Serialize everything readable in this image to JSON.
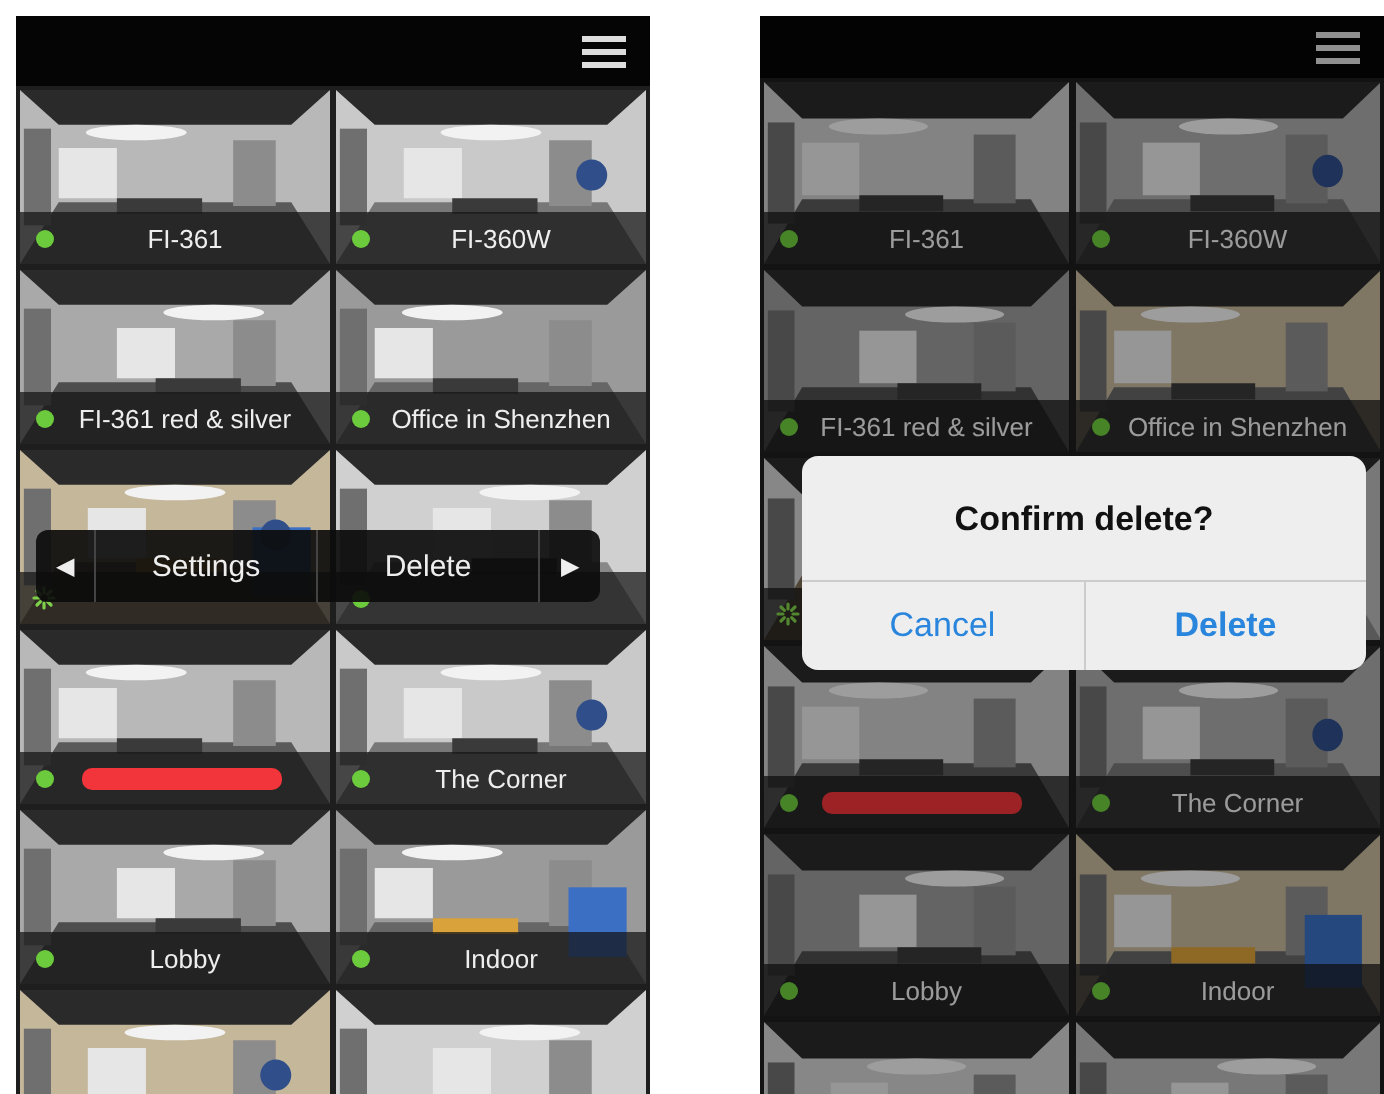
{
  "screens": [
    {
      "kind": "action_menu",
      "cameras": [
        {
          "kind": "labeled",
          "name": "FI-361",
          "online": true
        },
        {
          "kind": "labeled",
          "name": "FI-360W",
          "online": true
        },
        {
          "kind": "labeled",
          "name": "FI-361 red & silver",
          "online": true
        },
        {
          "kind": "labeled",
          "name": "Office in Shenzhen",
          "online": true
        },
        {
          "kind": "labeled",
          "connecting": true
        },
        {
          "kind": "labeled",
          "online": true
        },
        {
          "kind": "labeled",
          "online": true,
          "redacted": true
        },
        {
          "kind": "labeled",
          "name": "The Corner",
          "online": true
        },
        {
          "kind": "labeled",
          "name": "Lobby",
          "online": true
        },
        {
          "kind": "labeled",
          "name": "Indoor",
          "online": true
        },
        {
          "kind": "picture"
        },
        {
          "kind": "picture"
        }
      ],
      "menu": {
        "prev": "◀",
        "items": [
          "Settings",
          "Delete"
        ],
        "next": "▶"
      }
    },
    {
      "kind": "confirm_dialog",
      "cameras": [
        {
          "kind": "labeled",
          "name": "FI-361",
          "online": true
        },
        {
          "kind": "labeled",
          "name": "FI-360W",
          "online": true
        },
        {
          "kind": "labeled",
          "name": "FI-361 red & silver",
          "online": true
        },
        {
          "kind": "labeled",
          "name": "Office in Shenzhen",
          "online": true
        },
        {
          "kind": "labeled",
          "connecting": true
        },
        {
          "kind": "picture"
        },
        {
          "kind": "labeled",
          "online": true,
          "redacted": true
        },
        {
          "kind": "labeled",
          "name": "The Corner",
          "online": true
        },
        {
          "kind": "labeled",
          "name": "Lobby",
          "online": true
        },
        {
          "kind": "labeled",
          "name": "Indoor",
          "online": true
        },
        {
          "kind": "picture"
        },
        {
          "kind": "picture"
        }
      ],
      "dialog": {
        "title": "Confirm delete?",
        "buttons": [
          {
            "label": "Cancel",
            "kind": "cancel"
          },
          {
            "label": "Delete",
            "kind": "destructive"
          }
        ]
      }
    }
  ]
}
